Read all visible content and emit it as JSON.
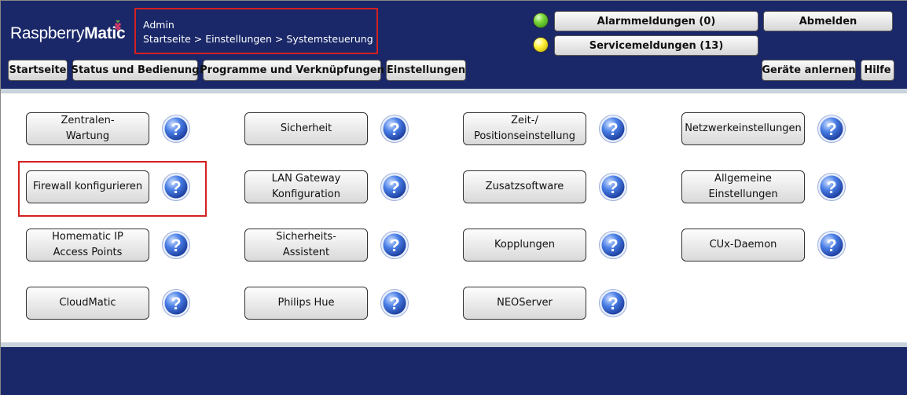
{
  "header": {
    "logo_text_a": "Raspberry",
    "logo_text_b": "Matic",
    "user": "Admin",
    "breadcrumb": "Startseite > Einstellungen > Systemsteuerung",
    "alarm_button": "Alarmmeldungen (0)",
    "service_button": "Servicemeldungen (13)",
    "logout_button": "Abmelden",
    "learn_button": "Geräte anlernen",
    "help_button": "Hilfe",
    "alarm_led_color": "#4cc21f",
    "service_led_color": "#f5e21a"
  },
  "nav": {
    "items": [
      "Startseite",
      "Status und Bedienung",
      "Programme und Verknüpfungen",
      "Einstellungen"
    ]
  },
  "tiles": [
    "Zentralen-\nWartung",
    "Sicherheit",
    "Zeit-/\nPositionseinstellung",
    "Netzwerkeinstellungen",
    "Firewall konfigurieren",
    "LAN Gateway\nKonfiguration",
    "Zusatzsoftware",
    "Allgemeine\nEinstellungen",
    "Homematic IP\nAccess Points",
    "Sicherheits-\nAssistent",
    "Kopplungen",
    "CUx-Daemon",
    "CloudMatic",
    "Philips Hue",
    "NEOServer"
  ],
  "help_icon": "question-mark-icon",
  "colors": {
    "header_bg": "#1a2869",
    "highlight": "#d42020",
    "help_blue": "#2a5bd0"
  }
}
